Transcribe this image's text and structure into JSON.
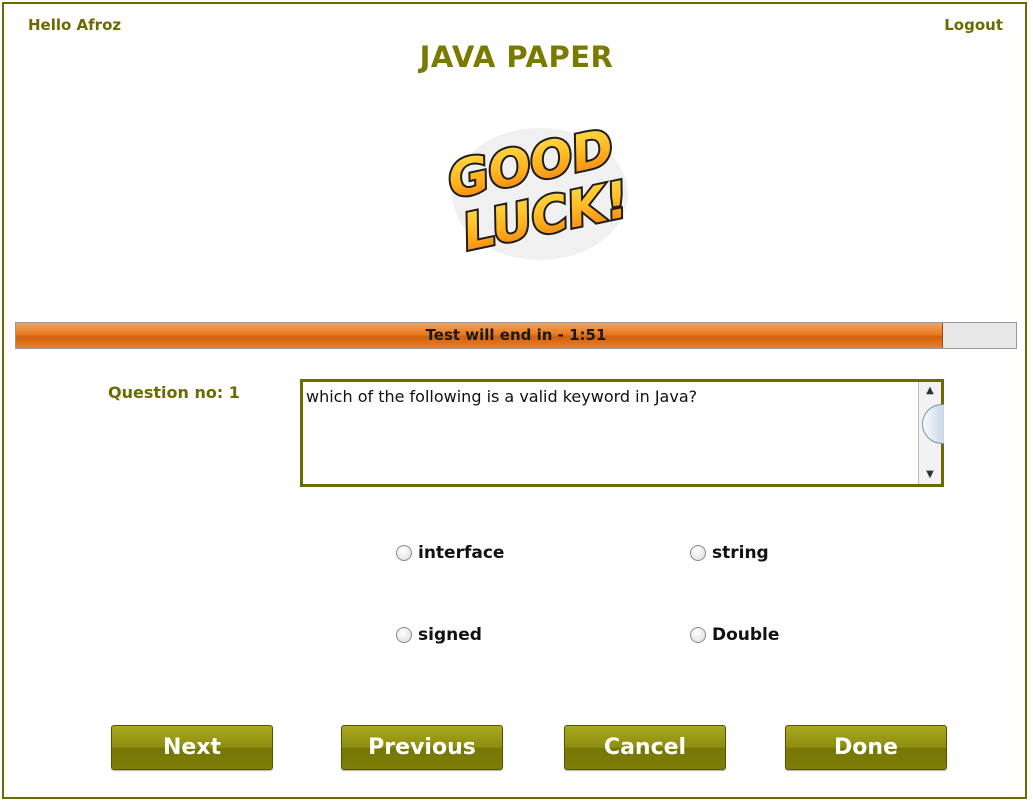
{
  "header": {
    "greeting": "Hello Afroz",
    "logout_label": "Logout",
    "title": "JAVA PAPER"
  },
  "logo": {
    "line1": "GOOD",
    "line2": "LUCK!"
  },
  "timer": {
    "text": "Test will end in - 1:51",
    "progress_percent": 92.6
  },
  "question": {
    "label": "Question no: 1",
    "text": "which of the following is a valid keyword in Java?"
  },
  "options": [
    {
      "label": "interface"
    },
    {
      "label": "string"
    },
    {
      "label": "signed"
    },
    {
      "label": "Double"
    }
  ],
  "buttons": {
    "next": "Next",
    "previous": "Previous",
    "cancel": "Cancel",
    "done": "Done"
  },
  "colors": {
    "accent": "#6b6b00",
    "progress": "#e97a22",
    "button": "#8d8d10"
  }
}
